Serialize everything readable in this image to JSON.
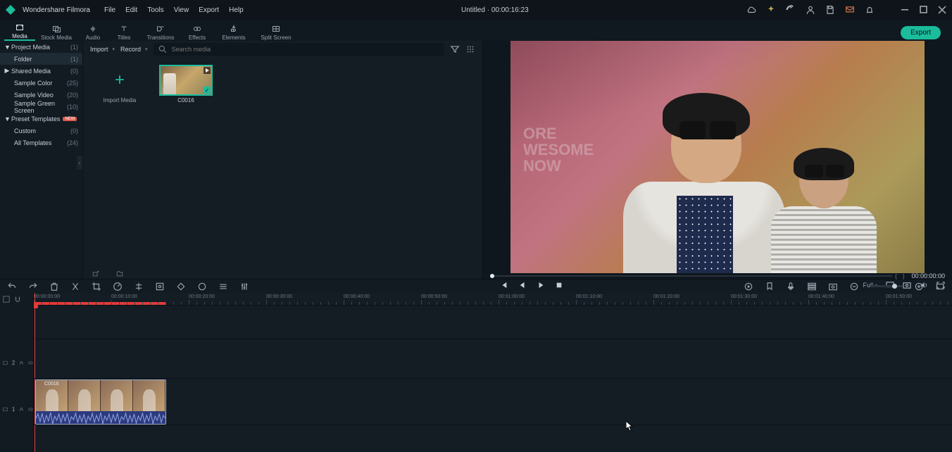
{
  "app_name": "Wondershare Filmora",
  "menu": [
    "File",
    "Edit",
    "Tools",
    "View",
    "Export",
    "Help"
  ],
  "project": {
    "title": "Untitled",
    "clock": "00:00:16:23"
  },
  "tabs": [
    {
      "key": "media",
      "label": "Media",
      "icon": "media-icon"
    },
    {
      "key": "stock",
      "label": "Stock Media",
      "icon": "stock-icon"
    },
    {
      "key": "audio",
      "label": "Audio",
      "icon": "audio-icon"
    },
    {
      "key": "titles",
      "label": "Titles",
      "icon": "titles-icon"
    },
    {
      "key": "transitions",
      "label": "Transitions",
      "icon": "transitions-icon"
    },
    {
      "key": "effects",
      "label": "Effects",
      "icon": "effects-icon"
    },
    {
      "key": "elements",
      "label": "Elements",
      "icon": "elements-icon"
    },
    {
      "key": "split",
      "label": "Split Screen",
      "icon": "split-icon"
    }
  ],
  "export_label": "Export",
  "side_tree": [
    {
      "label": "Project Media",
      "count": "(1)",
      "caret": "▼"
    },
    {
      "label": "Folder",
      "count": "(1)",
      "indent": true,
      "selected": true
    },
    {
      "label": "Shared Media",
      "count": "(0)",
      "caret": "▶"
    },
    {
      "label": "Sample Color",
      "count": "(25)",
      "indent": true
    },
    {
      "label": "Sample Video",
      "count": "(20)",
      "indent": true
    },
    {
      "label": "Sample Green Screen",
      "count": "(10)",
      "indent": true
    },
    {
      "label": "Preset Templates",
      "count": "",
      "caret": "▼",
      "badge": "NEW"
    },
    {
      "label": "Custom",
      "count": "(0)",
      "indent": true
    },
    {
      "label": "All Templates",
      "count": "(24)",
      "indent": true
    }
  ],
  "media_toolbar": {
    "import_label": "Import",
    "record_label": "Record",
    "search_placeholder": "Search media"
  },
  "import_tile_label": "Import Media",
  "clips": [
    {
      "name": "C0016",
      "duration": "17s"
    }
  ],
  "preview": {
    "bg_text": "ORE\nWESOME\nNOW",
    "scrub_time": "00:00:00:00",
    "full_label": "Full"
  },
  "ruler_labels": [
    "00:00:00:00",
    "00:00:10:00",
    "00:00:20:00",
    "00:00:30:00",
    "00:00:40:00",
    "00:00:50:00",
    "00:01:00:00",
    "00:01:10:00",
    "00:01:20:00",
    "00:01:30:00",
    "00:01:40:00",
    "00:01:50:00"
  ],
  "ruler_sel_width": 188,
  "playhead_x": 1,
  "tracks": {
    "t2": "2",
    "t1": "1"
  },
  "clip_on_track": {
    "name": "C0016"
  }
}
